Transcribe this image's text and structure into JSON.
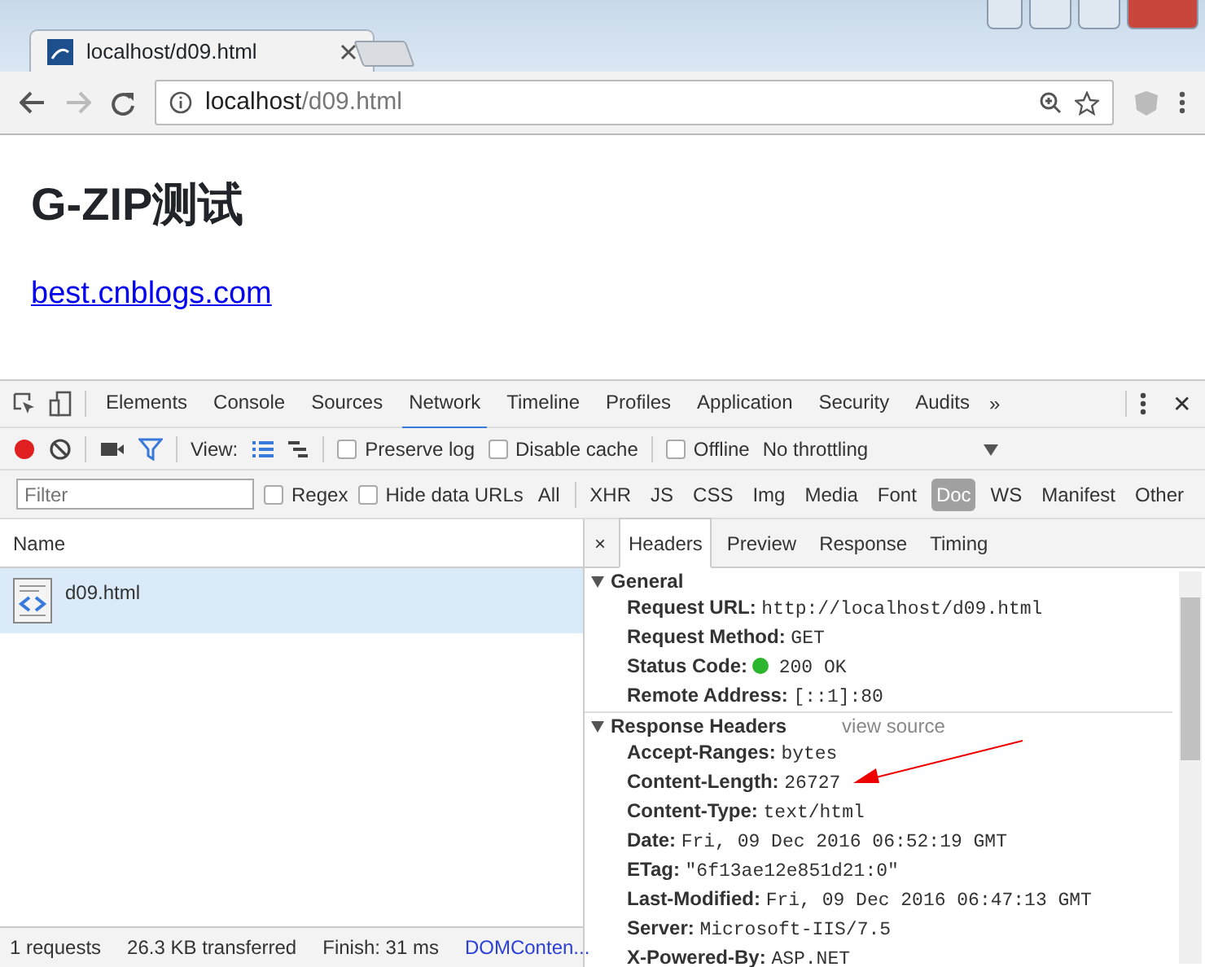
{
  "browser": {
    "tab_title": "localhost/d09.html",
    "address": {
      "host": "localhost",
      "path": "/d09.html"
    }
  },
  "page": {
    "heading": "G-ZIP测试",
    "link": "best.cnblogs.com"
  },
  "devtools": {
    "tabs": [
      {
        "label": "Elements",
        "selected": false
      },
      {
        "label": "Console",
        "selected": false
      },
      {
        "label": "Sources",
        "selected": false
      },
      {
        "label": "Network",
        "selected": true
      },
      {
        "label": "Timeline",
        "selected": false
      },
      {
        "label": "Profiles",
        "selected": false
      },
      {
        "label": "Application",
        "selected": false
      },
      {
        "label": "Security",
        "selected": false
      },
      {
        "label": "Audits",
        "selected": false
      }
    ],
    "more": "»",
    "close": "✕",
    "recording": true,
    "filter_active": true,
    "view_label": "View:",
    "options": [
      {
        "label": "Preserve log",
        "checked": false
      },
      {
        "label": "Disable cache",
        "checked": false
      },
      {
        "label": "Offline",
        "checked": false
      }
    ],
    "throttling": "No throttling",
    "filter": {
      "placeholder": "Filter"
    },
    "filter_options": [
      {
        "label": "Regex",
        "checked": false
      },
      {
        "label": "Hide data URLs",
        "checked": false
      }
    ],
    "type_filters": [
      {
        "label": "All",
        "selected": false
      },
      {
        "label": "XHR",
        "selected": false
      },
      {
        "label": "JS",
        "selected": false
      },
      {
        "label": "CSS",
        "selected": false
      },
      {
        "label": "Img",
        "selected": false
      },
      {
        "label": "Media",
        "selected": false
      },
      {
        "label": "Font",
        "selected": false
      },
      {
        "label": "Doc",
        "selected": true
      },
      {
        "label": "WS",
        "selected": false
      },
      {
        "label": "Manifest",
        "selected": false
      },
      {
        "label": "Other",
        "selected": false
      }
    ],
    "requests": {
      "column": "Name",
      "rows": [
        {
          "name": "d09.html",
          "selected": true
        }
      ]
    },
    "status_bar": [
      "1 requests",
      "26.3 KB transferred",
      "Finish: 31 ms",
      "DOMConten..."
    ],
    "detail": {
      "close": "×",
      "tabs": [
        {
          "label": "Headers",
          "selected": true
        },
        {
          "label": "Preview",
          "selected": false
        },
        {
          "label": "Response",
          "selected": false
        },
        {
          "label": "Timing",
          "selected": false
        }
      ],
      "sections": [
        {
          "title": "General",
          "expanded": true,
          "rows": [
            {
              "key": "Request URL:",
              "value": "http://localhost/d09.html"
            },
            {
              "key": "Request Method:",
              "value": "GET"
            },
            {
              "key": "Status Code:",
              "value": "200 OK",
              "color": "#2db52d"
            },
            {
              "key": "Remote Address:",
              "value": "[::1]:80"
            }
          ]
        },
        {
          "title": "Response Headers",
          "expanded": true,
          "link": "view source",
          "rows": [
            {
              "key": "Accept-Ranges:",
              "value": "bytes"
            },
            {
              "key": "Content-Length:",
              "value": "26727",
              "annotated": true
            },
            {
              "key": "Content-Type:",
              "value": "text/html"
            },
            {
              "key": "Date:",
              "value": "Fri, 09 Dec 2016 06:52:19 GMT"
            },
            {
              "key": "ETag:",
              "value": "\"6f13ae12e851d21:0\""
            },
            {
              "key": "Last-Modified:",
              "value": "Fri, 09 Dec 2016 06:47:13 GMT"
            },
            {
              "key": "Server:",
              "value": "Microsoft-IIS/7.5"
            },
            {
              "key": "X-Powered-By:",
              "value": "ASP.NET"
            }
          ]
        }
      ]
    }
  }
}
